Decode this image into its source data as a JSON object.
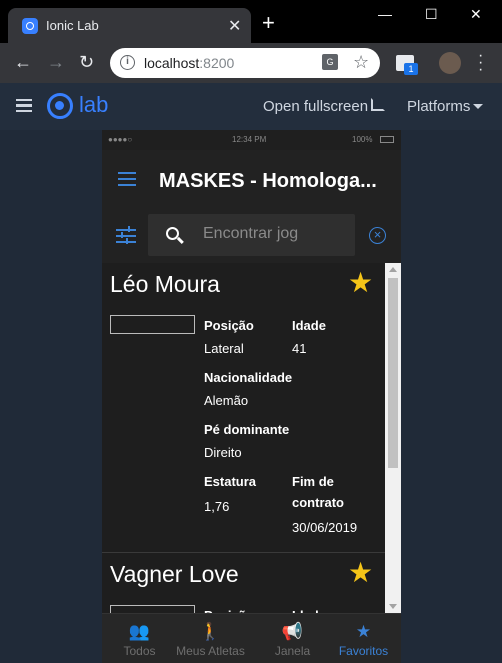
{
  "browser": {
    "tab_title": "Ionic Lab",
    "url_host": "localhost",
    "url_port": ":8200",
    "extension_badge": "1"
  },
  "lab": {
    "logo_text": "lab",
    "fullscreen_label": "Open fullscreen",
    "platforms_label": "Platforms"
  },
  "device": {
    "status_signal": "●●●●○",
    "status_time": "12:34 PM",
    "status_battery": "100%",
    "app_title": "MASKES - Homologa...",
    "search_placeholder": "Encontrar jogadores",
    "players": [
      {
        "name": "Léo Moura",
        "position_label": "Posição",
        "position": "Lateral",
        "age_label": "Idade",
        "age": "41",
        "nationality_label": "Nacionalidade",
        "nationality": "Alemão",
        "foot_label": "Pé dominante",
        "foot": "Direito",
        "height_label": "Estatura",
        "height": "1,76",
        "contract_label_1": "Fim de",
        "contract_label_2": "contrato",
        "contract_end": "30/06/2019"
      },
      {
        "name": "Vagner Love",
        "position_label": "Posição",
        "age_label": "Idade"
      }
    ],
    "tabs": [
      {
        "label": "Todos",
        "icon": "people-icon"
      },
      {
        "label": "Meus Atletas",
        "icon": "walk-icon"
      },
      {
        "label": "Janela",
        "icon": "megaphone-icon"
      },
      {
        "label": "Favoritos",
        "icon": "star-icon"
      }
    ],
    "active_tab": "Favoritos"
  },
  "colors": {
    "accent": "#3b82d6",
    "ionic_blue": "#3880ff",
    "favorite_star": "#f5c518"
  }
}
